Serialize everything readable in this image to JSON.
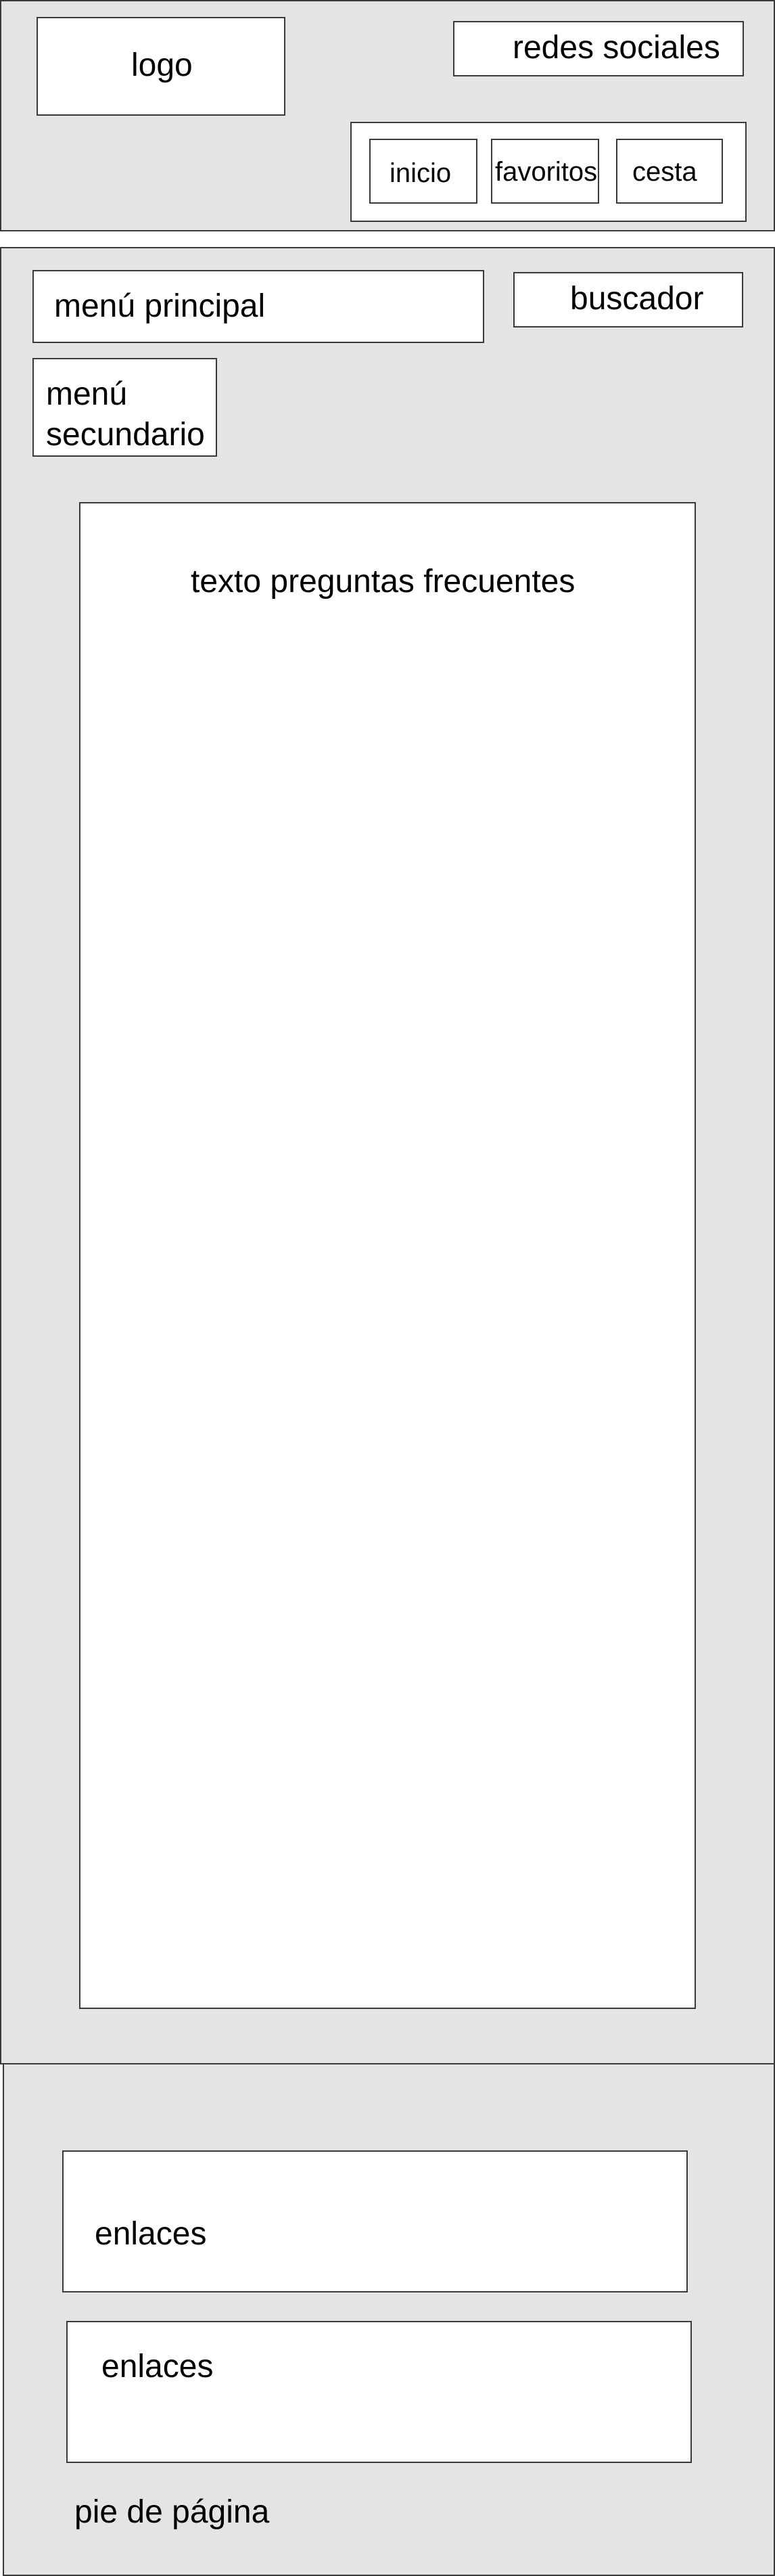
{
  "header": {
    "logo_label": "logo",
    "social_label": "redes sociales",
    "nav_items": [
      "inicio",
      "favoritos",
      "cesta"
    ]
  },
  "main": {
    "main_menu_label": "menú principal",
    "search_label": "buscador",
    "secondary_menu_line1": "menú",
    "secondary_menu_line2": "secundario",
    "faq_text": "texto preguntas frecuentes"
  },
  "footer": {
    "links": [
      "enlaces",
      "enlaces"
    ],
    "label": "pie de página"
  },
  "colors": {
    "panel_background": "#e4e4e4",
    "box_background": "#ffffff",
    "border": "#3a3a3a"
  }
}
